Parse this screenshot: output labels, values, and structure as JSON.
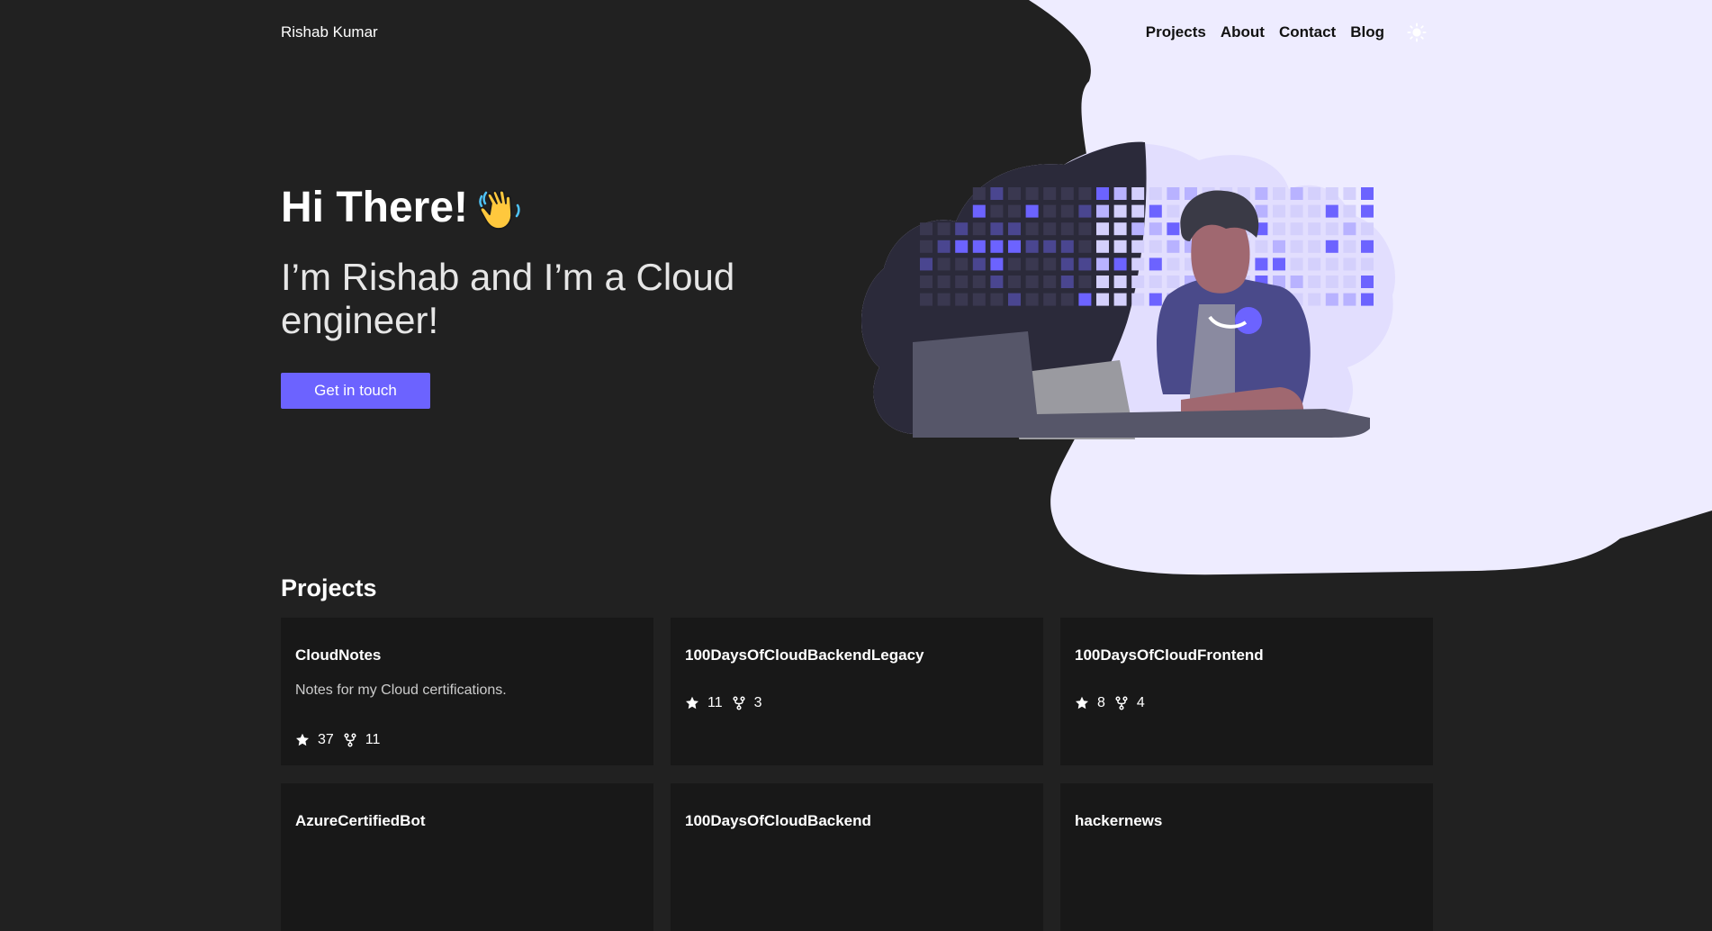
{
  "brand": "Rishab Kumar",
  "nav": {
    "links": [
      "Projects",
      "About",
      "Contact",
      "Blog"
    ],
    "theme_icon": "sun-icon"
  },
  "hero": {
    "title": "Hi There!",
    "wave_icon": "waving-hand-icon",
    "subtitle": "I’m Rishab and I’m a Cloud engineer!",
    "cta": "Get in touch"
  },
  "projects": {
    "title": "Projects",
    "cards": [
      {
        "name": "CloudNotes",
        "description": "Notes for my Cloud certifications.",
        "stars": "37",
        "forks": "11"
      },
      {
        "name": "100DaysOfCloudBackendLegacy",
        "description": "",
        "stars": "11",
        "forks": "3"
      },
      {
        "name": "100DaysOfCloudFrontend",
        "description": "",
        "stars": "8",
        "forks": "4"
      },
      {
        "name": "AzureCertifiedBot",
        "description": "",
        "stars": "",
        "forks": ""
      },
      {
        "name": "100DaysOfCloudBackend",
        "description": "",
        "stars": "",
        "forks": ""
      },
      {
        "name": "hackernews",
        "description": "",
        "stars": "",
        "forks": ""
      }
    ]
  },
  "colors": {
    "background": "#212121",
    "accent": "#6c63ff",
    "blob": "#eeecff",
    "card": "#181818"
  }
}
